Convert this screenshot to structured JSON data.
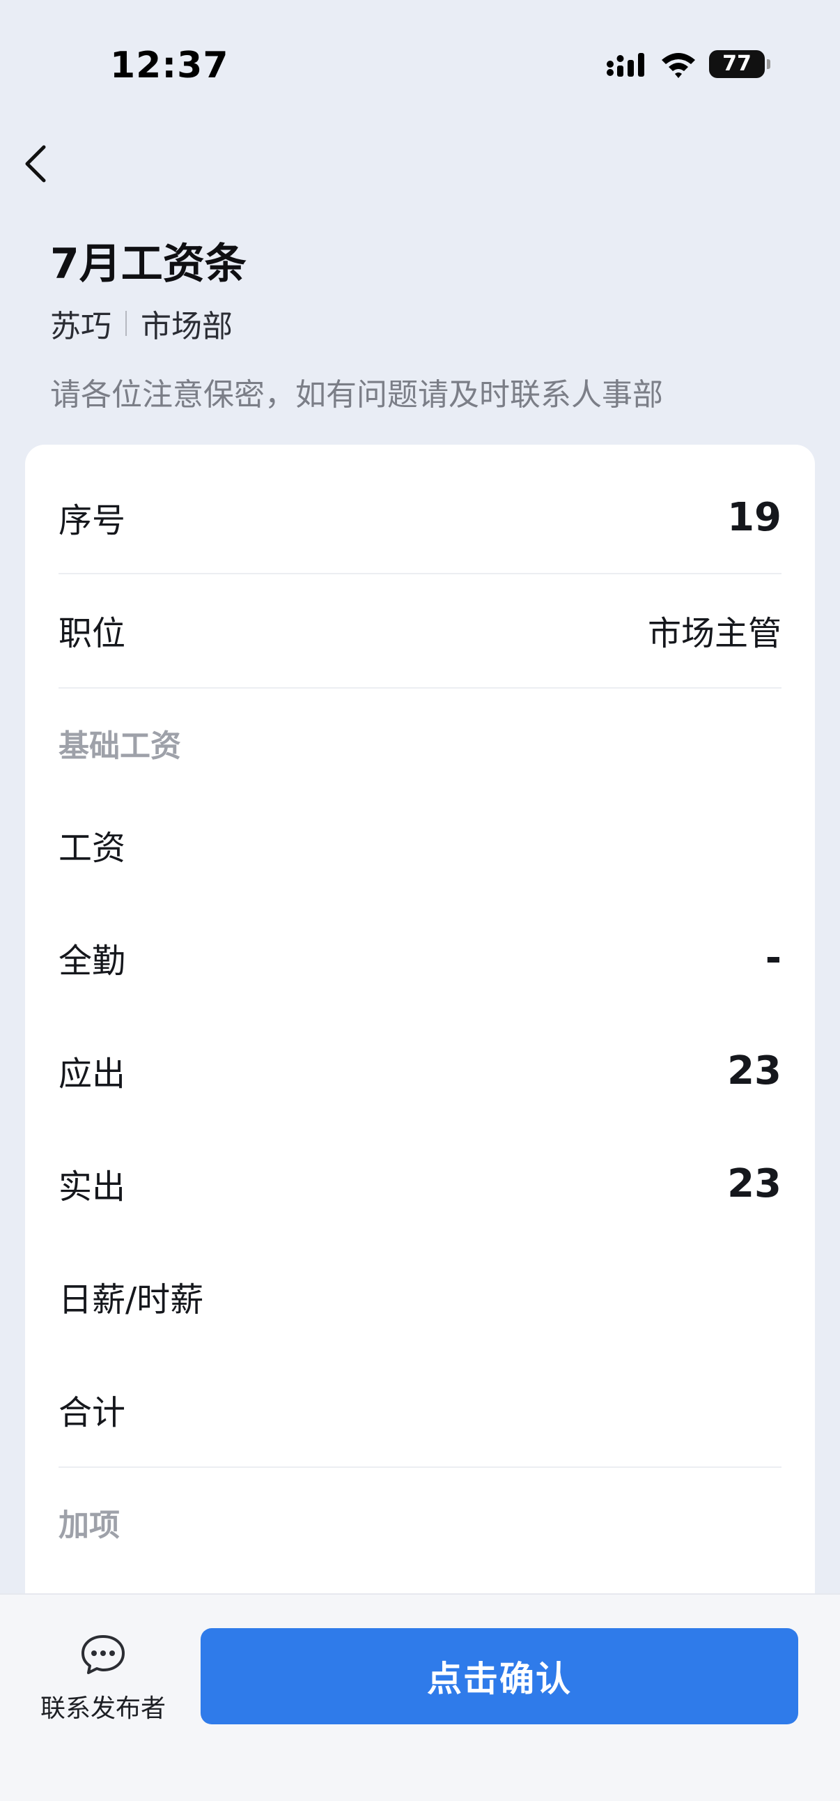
{
  "status_bar": {
    "time": "12:37",
    "battery": "77"
  },
  "header": {
    "title": "7月工资条",
    "employee_name": "苏巧",
    "department": "市场部",
    "notice": "请各位注意保密，如有问题请及时联系人事部"
  },
  "card": {
    "rows_top": [
      {
        "label": "序号",
        "value": "19"
      },
      {
        "label": "职位",
        "value": "市场主管"
      }
    ],
    "section_basic": "基础工资",
    "rows_basic": [
      {
        "label": "工资",
        "value": ""
      },
      {
        "label": "全勤",
        "value": "-"
      },
      {
        "label": "应出",
        "value": "23"
      },
      {
        "label": "实出",
        "value": "23"
      },
      {
        "label": "日薪/时薪",
        "value": ""
      },
      {
        "label": "合计",
        "value": ""
      }
    ],
    "section_plus": "加项"
  },
  "bottom": {
    "contact_label": "联系发布者",
    "confirm_label": "点击确认"
  },
  "colors": {
    "page_bg": "#e9edf5",
    "accent": "#2f7bea"
  },
  "icons": [
    "back-chevron-icon",
    "signal-icon",
    "wifi-icon",
    "battery-icon",
    "chat-bubble-icon"
  ]
}
